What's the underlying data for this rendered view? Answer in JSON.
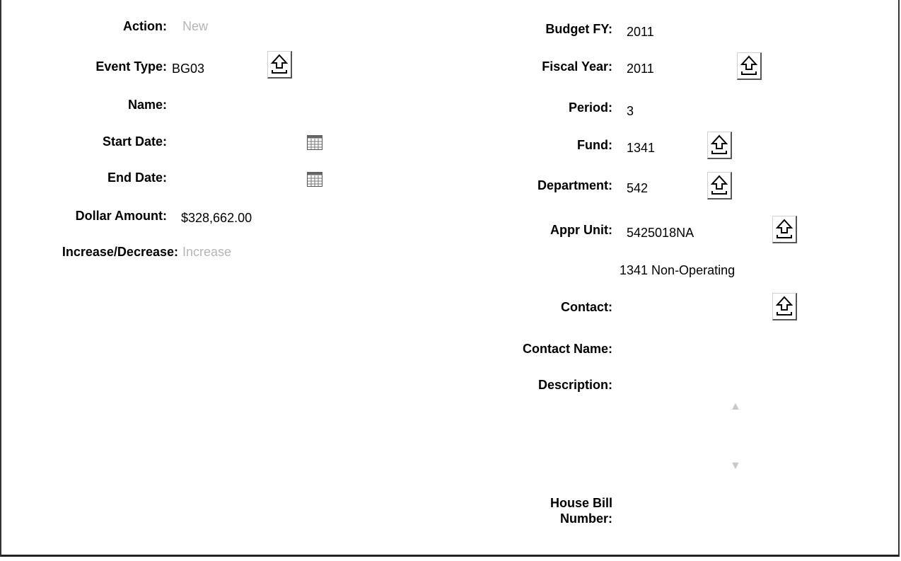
{
  "left": {
    "action": {
      "label": "Action:",
      "value": "New"
    },
    "event_type": {
      "label": "Event Type:",
      "value": "BG03"
    },
    "name": {
      "label": "Name:",
      "value": ""
    },
    "start_date": {
      "label": "Start Date:",
      "value": ""
    },
    "end_date": {
      "label": "End Date:",
      "value": ""
    },
    "dollar_amount": {
      "label": "Dollar Amount:",
      "value": "$328,662.00"
    },
    "increase_decrease": {
      "label": "Increase/Decrease:",
      "value": "Increase"
    }
  },
  "right": {
    "budget_fy": {
      "label": "Budget FY:",
      "value": "2011"
    },
    "fiscal_year": {
      "label": "Fiscal Year:",
      "value": "2011"
    },
    "period": {
      "label": "Period:",
      "value": "3"
    },
    "fund": {
      "label": "Fund:",
      "value": "1341"
    },
    "department": {
      "label": "Department:",
      "value": "542"
    },
    "appr_unit": {
      "label": "Appr Unit:",
      "value": "5425018NA",
      "description": "1341 Non-Operating"
    },
    "contact": {
      "label": "Contact:",
      "value": ""
    },
    "contact_name": {
      "label": "Contact Name:",
      "value": ""
    },
    "description": {
      "label": "Description:",
      "value": ""
    },
    "house_bill_line1": "House Bill",
    "house_bill_line2": "Number:"
  },
  "icons": {
    "lookup": "lookup-arrow-icon",
    "calendar": "calendar-icon"
  }
}
